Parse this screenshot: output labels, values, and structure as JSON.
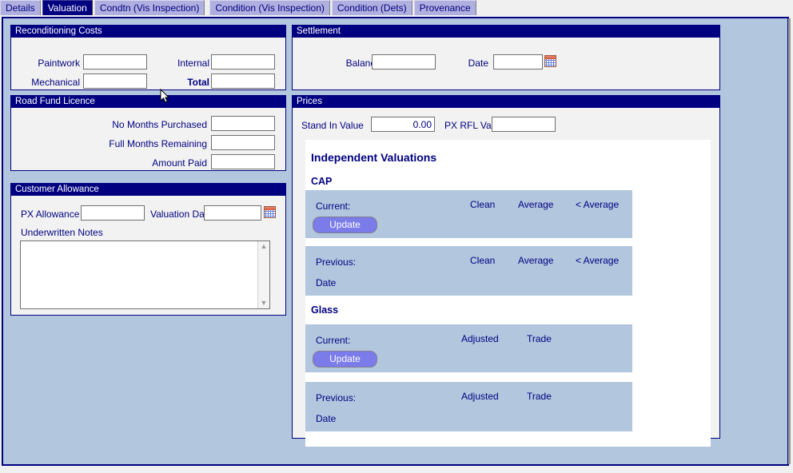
{
  "tabs": [
    {
      "label": "Details",
      "active": false
    },
    {
      "label": "Valuation",
      "active": true
    },
    {
      "label": "Condtn (Vis Inspection)",
      "active": false
    },
    {
      "label": "Condition (Vis Inspection)",
      "active": false
    },
    {
      "label": "Condition (Dets)",
      "active": false
    },
    {
      "label": "Provenance",
      "active": false
    }
  ],
  "reconditioning": {
    "title": "Reconditioning Costs",
    "paintwork_label": "Paintwork",
    "paintwork_value": "",
    "internal_label": "Internal",
    "internal_value": "",
    "mechanical_label": "Mechanical",
    "mechanical_value": "",
    "total_label": "Total",
    "total_value": ""
  },
  "road_fund": {
    "title": "Road Fund Licence",
    "months_purchased_label": "No Months Purchased",
    "months_purchased_value": "",
    "months_remaining_label": "Full Months Remaining",
    "months_remaining_value": "",
    "amount_paid_label": "Amount Paid",
    "amount_paid_value": ""
  },
  "customer_allowance": {
    "title": "Customer Allowance",
    "px_allowance_label": "PX Allowance",
    "px_allowance_value": "",
    "valuation_date_label": "Valuation Date",
    "valuation_date_value": "",
    "notes_label": "Underwritten Notes",
    "notes_value": ""
  },
  "settlement": {
    "title": "Settlement",
    "balance_label": "Balance",
    "balance_value": "",
    "date_label": "Date",
    "date_value": ""
  },
  "prices": {
    "title": "Prices",
    "stand_in_value_label": "Stand In Value",
    "stand_in_value": "0.00",
    "px_rfl_val_label": "PX RFL Val",
    "px_rfl_val": "",
    "valuations_heading": "Independent Valuations",
    "cap": {
      "heading": "CAP",
      "current": {
        "row_label": "Current:",
        "columns": [
          "Clean",
          "Average",
          "< Average"
        ],
        "values": [
          "",
          "",
          ""
        ],
        "update_label": "Update"
      },
      "previous": {
        "row_label": "Previous:",
        "date_label": "Date",
        "date_value": "",
        "columns": [
          "Clean",
          "Average",
          "< Average"
        ],
        "values": [
          "",
          "",
          ""
        ]
      }
    },
    "glass": {
      "heading": "Glass",
      "current": {
        "row_label": "Current:",
        "columns": [
          "Adjusted",
          "Trade"
        ],
        "values": [
          "",
          ""
        ],
        "update_label": "Update"
      },
      "previous": {
        "row_label": "Previous:",
        "date_label": "Date",
        "date_value": "",
        "columns": [
          "Adjusted",
          "Trade"
        ],
        "values": [
          "",
          ""
        ]
      }
    }
  },
  "colors": {
    "panel_title_bg": "#000080",
    "content_bg": "#b2c6de",
    "block_bg": "#b2c6de",
    "button_bg": "#7b7bea",
    "tab_bg": "#b0b0e0",
    "text": "#000080"
  }
}
